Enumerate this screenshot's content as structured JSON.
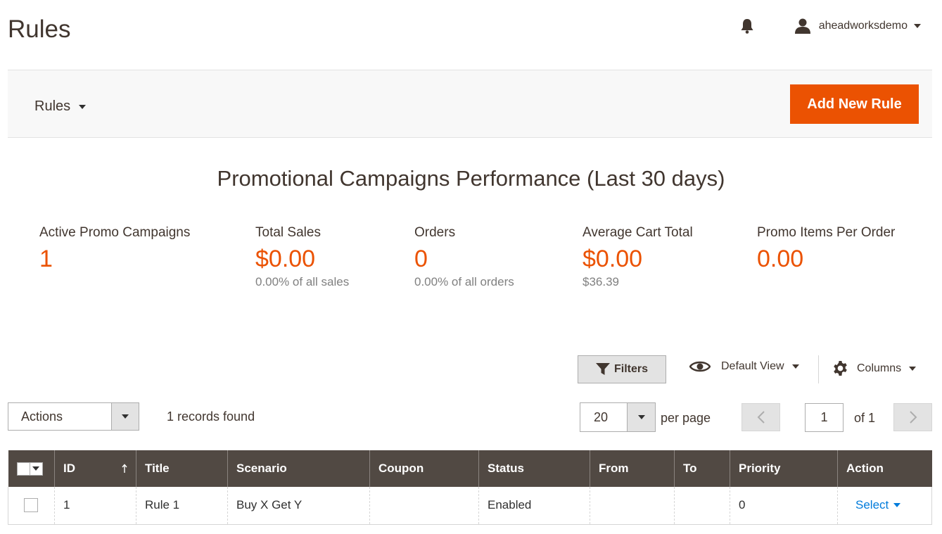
{
  "page_title": "Rules",
  "header": {
    "user_name": "aheadworksdemo"
  },
  "toolbar": {
    "switcher_label": "Rules",
    "add_button": "Add New Rule"
  },
  "performance": {
    "title": "Promotional Campaigns Performance (Last 30 days)",
    "stats": [
      {
        "label": "Active Promo Campaigns",
        "value": "1",
        "sub": ""
      },
      {
        "label": "Total Sales",
        "value": "$0.00",
        "sub": "0.00% of all sales"
      },
      {
        "label": "Orders",
        "value": "0",
        "sub": "0.00% of all orders"
      },
      {
        "label": "Average Cart Total",
        "value": "$0.00",
        "sub": "$36.39"
      },
      {
        "label": "Promo Items Per Order",
        "value": "0.00",
        "sub": ""
      }
    ]
  },
  "grid_controls": {
    "filters_label": "Filters",
    "view_label": "Default View",
    "columns_label": "Columns",
    "actions_label": "Actions",
    "records_found": "1 records found",
    "per_page_value": "20",
    "per_page_label": "per page",
    "current_page": "1",
    "total_pages_label": "of 1"
  },
  "table": {
    "columns": [
      "ID",
      "Title",
      "Scenario",
      "Coupon",
      "Status",
      "From",
      "To",
      "Priority",
      "Action"
    ],
    "rows": [
      {
        "id": "1",
        "title": "Rule 1",
        "scenario": "Buy X Get Y",
        "coupon": "",
        "status": "Enabled",
        "from": "",
        "to": "",
        "priority": "0",
        "action": "Select"
      }
    ]
  },
  "colors": {
    "accent": "#eb5202",
    "header_bg": "#514943",
    "link": "#007bdb"
  }
}
